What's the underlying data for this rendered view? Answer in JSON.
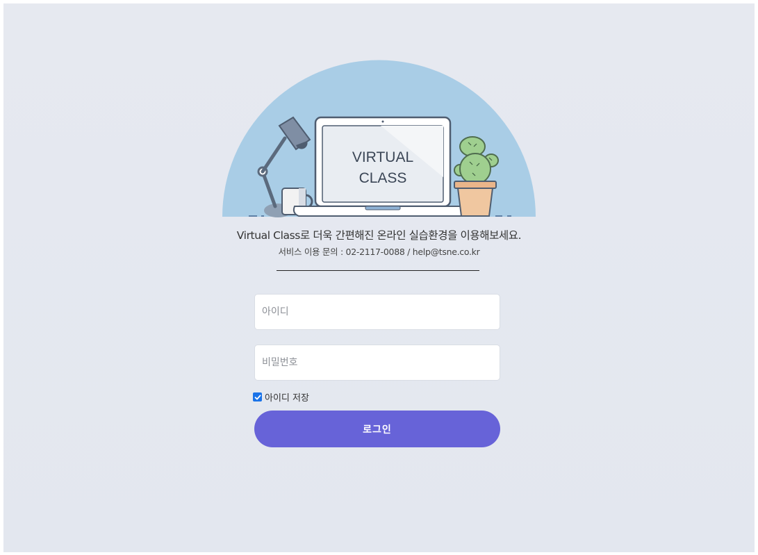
{
  "hero": {
    "screen_line1": "VIRTUAL",
    "screen_line2": "CLASS"
  },
  "tagline": "Virtual Class로 더욱 간편해진 온라인 실습환경을 이용해보세요.",
  "contact": "서비스 이용 문의 : 02-2117-0088 / help@tsne.co.kr",
  "form": {
    "id_placeholder": "아이디",
    "id_value": "",
    "password_placeholder": "비밀번호",
    "password_value": "",
    "remember_label": "아이디 저장",
    "remember_checked": true,
    "login_label": "로그인"
  },
  "colors": {
    "background": "#e4e8ef",
    "accent": "#6763d8",
    "hero_circle": "#a9cde6",
    "checkbox": "#1a73e8"
  }
}
